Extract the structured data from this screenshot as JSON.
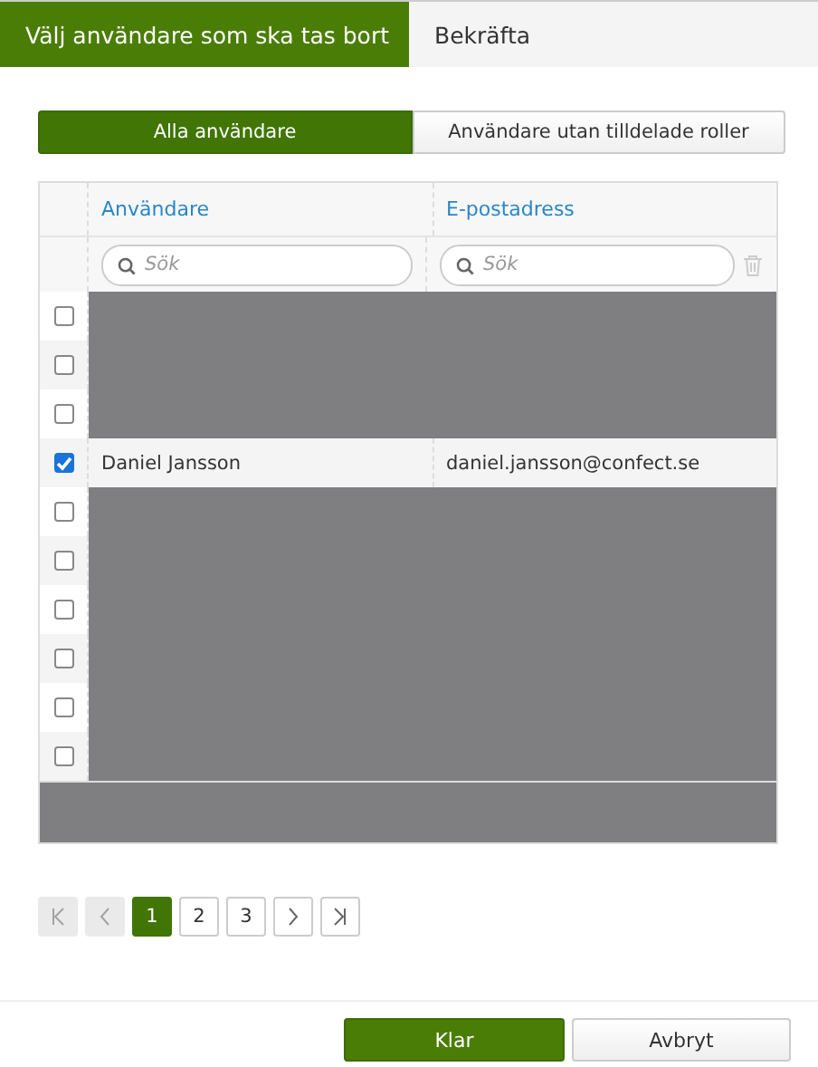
{
  "steps": [
    {
      "label": "Välj användare som ska tas bort",
      "selected": true
    },
    {
      "label": "Bekräfta",
      "selected": false
    }
  ],
  "filter_tabs": [
    {
      "label": "Alla användare",
      "selected": true
    },
    {
      "label": "Användare utan tilldelade roller",
      "selected": false
    }
  ],
  "table": {
    "columns": [
      {
        "label": "Användare",
        "placeholder": "Sök"
      },
      {
        "label": "E-postadress",
        "placeholder": "Sök"
      }
    ],
    "rows": [
      {
        "kind": "redacted",
        "checked": false
      },
      {
        "kind": "redacted",
        "checked": false
      },
      {
        "kind": "redacted",
        "checked": false
      },
      {
        "kind": "user",
        "checked": true,
        "name": "Daniel Jansson",
        "email": "daniel.jansson@confect.se"
      },
      {
        "kind": "redacted",
        "checked": false
      },
      {
        "kind": "redacted",
        "checked": false
      },
      {
        "kind": "redacted",
        "checked": false
      },
      {
        "kind": "redacted",
        "checked": false
      },
      {
        "kind": "redacted",
        "checked": false
      },
      {
        "kind": "redacted",
        "checked": false
      }
    ],
    "footer_redacted": true
  },
  "pagination": {
    "first_disabled": true,
    "prev_disabled": true,
    "next_disabled": false,
    "last_disabled": false,
    "pages": [
      {
        "label": "1",
        "selected": true
      },
      {
        "label": "2",
        "selected": false
      },
      {
        "label": "3",
        "selected": false
      }
    ]
  },
  "buttons": [
    {
      "kind": "primary",
      "label": "Klar"
    },
    {
      "kind": "secondary",
      "label": "Avbryt"
    }
  ]
}
